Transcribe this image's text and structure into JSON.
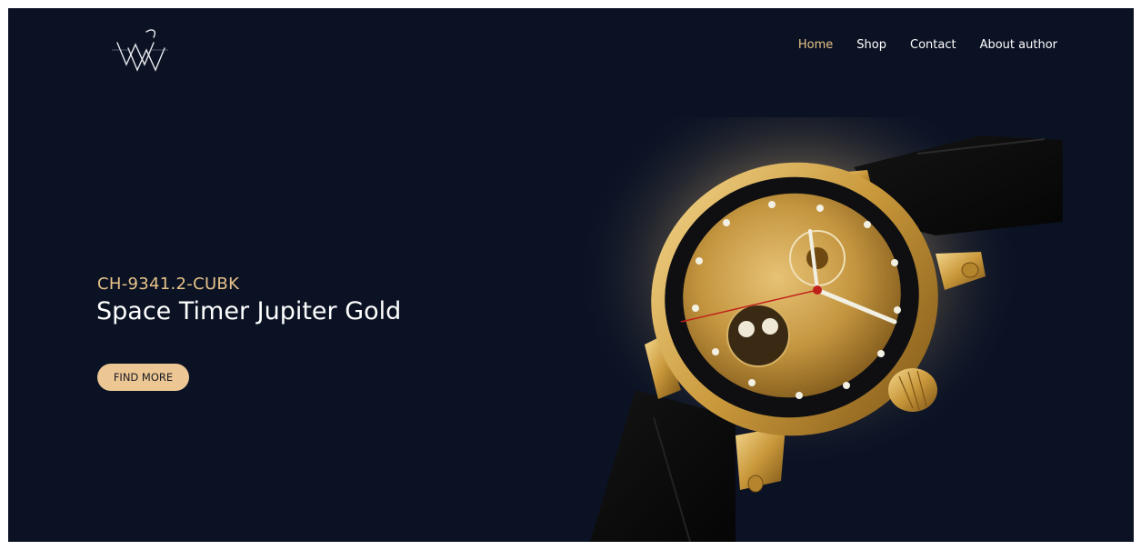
{
  "brand": {
    "logo_icon": "wv-monogram-logo"
  },
  "nav": {
    "items": [
      {
        "label": "Home",
        "active": true
      },
      {
        "label": "Shop",
        "active": false
      },
      {
        "label": "Contact",
        "active": false
      },
      {
        "label": "About author",
        "active": false
      }
    ]
  },
  "hero": {
    "model_code": "CH-9341.2-CUBK",
    "product_name": "Space Timer Jupiter Gold",
    "cta_label": "FIND MORE",
    "image_icon": "gold-wristwatch-image"
  },
  "colors": {
    "background": "#0a1224",
    "accent": "#e8c38a",
    "button": "#ecc794",
    "text": "#ffffff"
  }
}
